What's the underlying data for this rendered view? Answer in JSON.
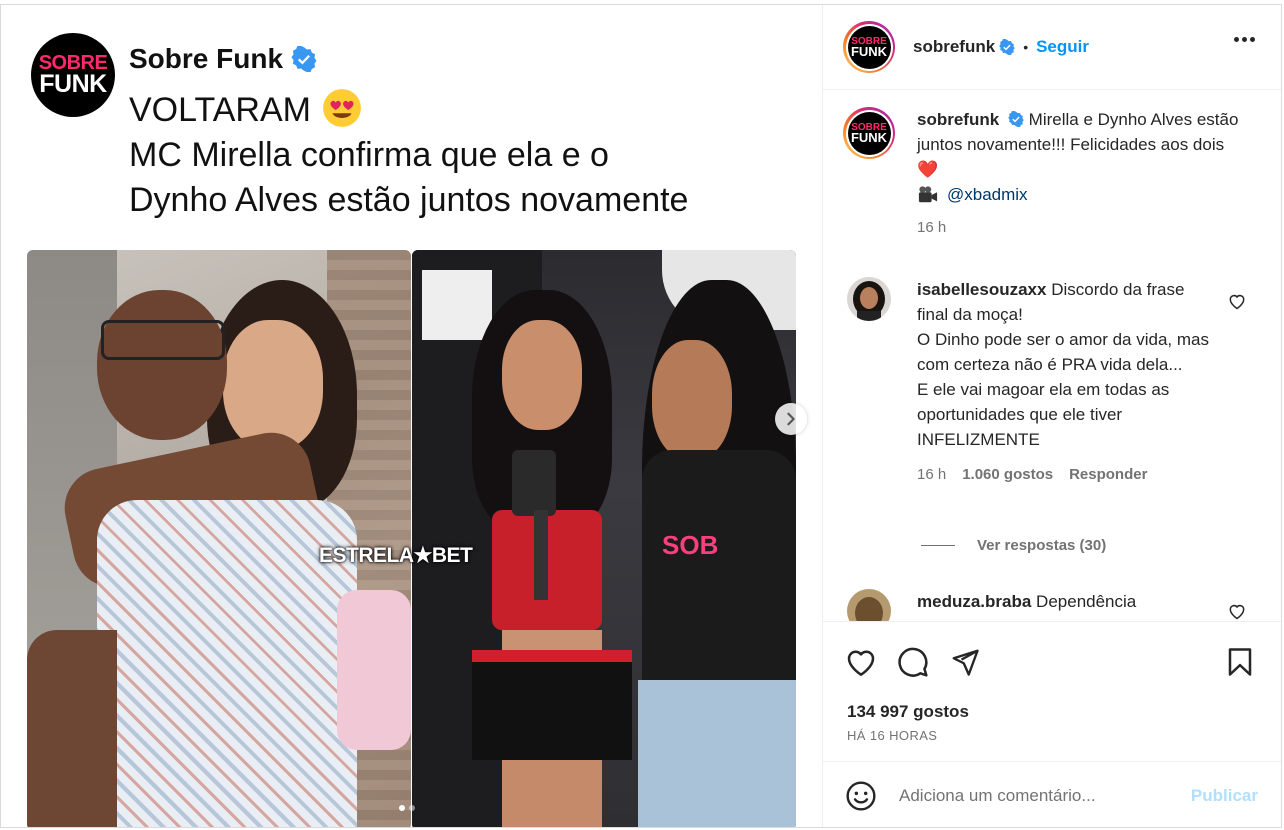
{
  "post": {
    "brand_name": "Sobre Funk",
    "logo_line1": "SOBRE",
    "logo_line2": "FUNK",
    "headline_line1": "VOLTARAM",
    "headline_line2": "MC Mirella confirma que ela e o",
    "headline_line3": "Dynho Alves estão juntos novamente",
    "watermark": "ESTRELA★BET",
    "carousel": {
      "slides": 2,
      "active": 1
    }
  },
  "header": {
    "username": "sobrefunk",
    "separator": "•",
    "follow_label": "Seguir"
  },
  "caption": {
    "username": "sobrefunk",
    "text": "Mirella e Dynho Alves estão juntos novamente!!! Felicidades aos dois ❤️",
    "mention": "@xbadmix",
    "time": "16 h"
  },
  "comments": [
    {
      "username": "isabellesouzaxx",
      "text_line1": "Discordo da frase final da moça!",
      "text_line2": "O Dinho pode ser o amor da vida, mas com certeza não é PRA vida dela...",
      "text_line3": "E ele vai magoar ela em todas as oportunidades que ele tiver INFELIZMENTE",
      "time": "16 h",
      "likes": "1.060 gostos",
      "reply_label": "Responder",
      "view_replies": "Ver respostas (30)"
    },
    {
      "username": "meduza.braba",
      "text": "Dependência"
    }
  ],
  "actions": {
    "likes_count": "134 997 gostos",
    "posted_ago": "HÁ 16 HORAS"
  },
  "composer": {
    "placeholder": "Adiciona um comentário...",
    "publish_label": "Publicar"
  },
  "colors": {
    "accent": "#0095f6",
    "publish_disabled": "#b2dffc",
    "verified": "#3897f0",
    "logo_pink": "#ff2a6d"
  },
  "icons": [
    "verified-badge-icon",
    "heart-eyes-emoji-icon",
    "chevron-right-icon",
    "more-options-icon",
    "heart-icon",
    "comment-icon",
    "share-icon",
    "bookmark-icon",
    "emoji-icon",
    "red-heart-emoji",
    "camera-emoji"
  ]
}
